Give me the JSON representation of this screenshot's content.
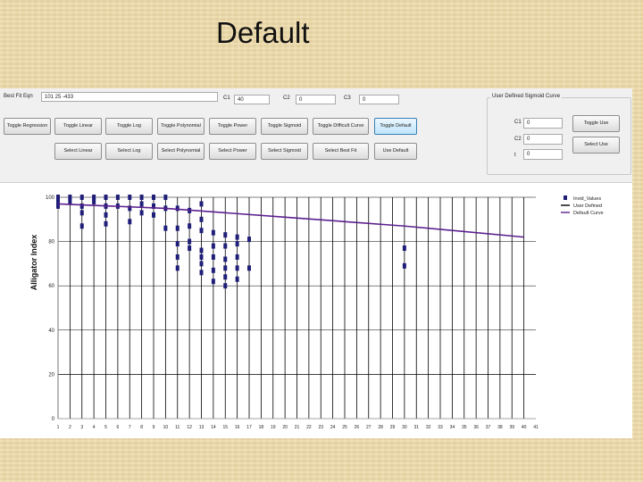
{
  "slide": {
    "title": "Default"
  },
  "controls": {
    "best_fit_label": "Best Fit Eqn",
    "best_fit_value": "101 25 -433",
    "c1_label": "C1",
    "c1_value": "40",
    "c2_label": "C2",
    "c2_value": "0",
    "c3_label": "C3",
    "c3_value": "0",
    "row1_buttons": [
      "Toggle Regression",
      "Toggle Linear",
      "Toggle Log",
      "Toggle Polynomial",
      "Toggle Power",
      "Toggle Sigmoid",
      "Toggle Difficult Curve",
      "Toggle Default"
    ],
    "row2_buttons": [
      "Select Linear",
      "Select Log",
      "Select Polynomial",
      "Select Power",
      "Select Sigmoid",
      "Select Best Fit",
      "Use Default"
    ]
  },
  "sigmoid_group": {
    "title": "User Defined Sigmoid Curve",
    "c1_label": "C1",
    "c1_value": "0",
    "c2_label": "C2",
    "c2_value": "0",
    "c3_label": "t",
    "c3_value": "0",
    "toggle_label": "Toggle Use",
    "select_label": "Select Use"
  },
  "chart_data": {
    "type": "scatter",
    "ylabel": "Alligator Index",
    "xlabel": "",
    "ylim": [
      0,
      100
    ],
    "yticks": [
      0,
      20,
      40,
      60,
      80,
      100
    ],
    "xlim": [
      1,
      41
    ],
    "xticks": [
      1,
      2,
      3,
      4,
      5,
      6,
      7,
      8,
      9,
      10,
      11,
      12,
      13,
      14,
      15,
      16,
      17,
      18,
      19,
      20,
      21,
      22,
      23,
      24,
      25,
      26,
      27,
      28,
      29,
      30,
      31,
      32,
      33,
      34,
      35,
      36,
      37,
      38,
      39,
      40,
      41
    ],
    "grid": "vertical-lines-at-each-observed-x, horizontal-at-20",
    "vertical_lines_x": [
      1,
      2,
      3,
      4,
      5,
      6,
      7,
      8,
      9,
      10,
      11,
      12,
      13,
      14,
      15,
      16,
      17,
      18,
      19,
      20,
      21,
      22,
      23,
      24,
      25,
      26,
      27,
      28,
      29,
      30,
      31,
      32,
      33,
      34,
      35,
      36,
      37,
      38,
      39,
      40
    ],
    "legend": {
      "position": "top-right",
      "entries": [
        "Invid_Values",
        "User Defined",
        "Default Curve"
      ]
    },
    "series": [
      {
        "name": "Invid_Values",
        "color": "#1f1f7a",
        "points": [
          [
            1,
            100
          ],
          [
            1,
            98
          ],
          [
            1,
            96
          ],
          [
            2,
            100
          ],
          [
            2,
            98
          ],
          [
            3,
            100
          ],
          [
            3,
            96
          ],
          [
            3,
            93
          ],
          [
            3,
            87
          ],
          [
            4,
            100
          ],
          [
            4,
            98
          ],
          [
            5,
            100
          ],
          [
            5,
            96
          ],
          [
            5,
            92
          ],
          [
            5,
            88
          ],
          [
            6,
            100
          ],
          [
            6,
            96
          ],
          [
            7,
            100
          ],
          [
            7,
            95
          ],
          [
            7,
            89
          ],
          [
            8,
            100
          ],
          [
            8,
            97
          ],
          [
            8,
            93
          ],
          [
            9,
            100
          ],
          [
            9,
            96
          ],
          [
            9,
            92
          ],
          [
            10,
            100
          ],
          [
            10,
            95
          ],
          [
            10,
            86
          ],
          [
            11,
            95
          ],
          [
            11,
            86
          ],
          [
            11,
            79
          ],
          [
            11,
            73
          ],
          [
            11,
            68
          ],
          [
            12,
            94
          ],
          [
            12,
            87
          ],
          [
            12,
            80
          ],
          [
            12,
            77
          ],
          [
            13,
            97
          ],
          [
            13,
            90
          ],
          [
            13,
            85
          ],
          [
            13,
            76
          ],
          [
            13,
            73
          ],
          [
            13,
            70
          ],
          [
            13,
            66
          ],
          [
            14,
            84
          ],
          [
            14,
            78
          ],
          [
            14,
            73
          ],
          [
            14,
            67
          ],
          [
            14,
            62
          ],
          [
            15,
            83
          ],
          [
            15,
            78
          ],
          [
            15,
            72
          ],
          [
            15,
            68
          ],
          [
            15,
            64
          ],
          [
            15,
            60
          ],
          [
            16,
            82
          ],
          [
            16,
            79
          ],
          [
            16,
            73
          ],
          [
            16,
            68
          ],
          [
            16,
            63
          ],
          [
            17,
            81
          ],
          [
            17,
            68
          ],
          [
            30,
            77
          ],
          [
            30,
            69
          ]
        ]
      },
      {
        "name": "User Defined",
        "color": "#000000",
        "points": []
      },
      {
        "name": "Default Curve",
        "color": "#5b1f8f",
        "points": [
          [
            1,
            97
          ],
          [
            10,
            95
          ],
          [
            20,
            91
          ],
          [
            30,
            87
          ],
          [
            40,
            82
          ]
        ]
      }
    ]
  }
}
